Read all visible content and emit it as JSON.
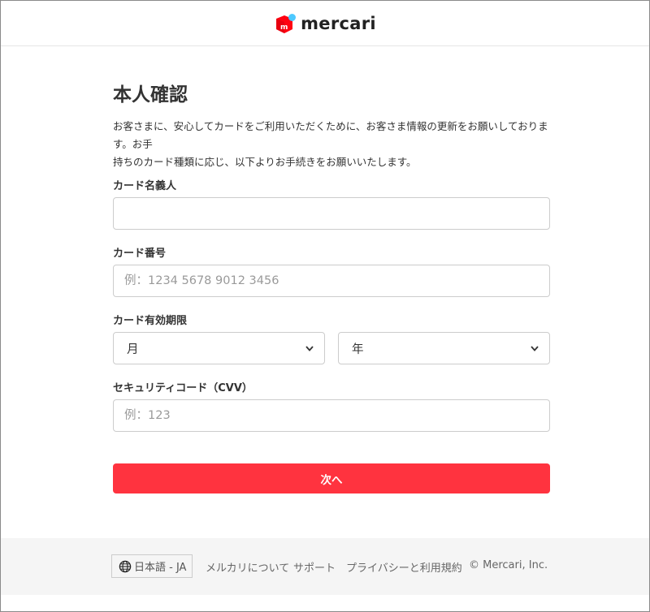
{
  "header": {
    "logo_text": "mercari",
    "logo_mark": "m"
  },
  "main": {
    "title": "本人確認",
    "intro_line1": "お客さまに、安心してカードをご利用いただくために、お客さま情報の更新をお願いしております。お手",
    "intro_line2": "持ちのカード種類に応じ、以下よりお手続きをお願いいたします。",
    "card_name": {
      "label": "カード名義人",
      "value": "",
      "placeholder": ""
    },
    "card_number": {
      "label": "カード番号",
      "value": "",
      "placeholder": "例：1234 5678 9012 3456"
    },
    "expiry": {
      "label": "カード有効期限",
      "month_value": "月",
      "year_value": "年"
    },
    "cvv": {
      "label": "セキュリティコード（CVV）",
      "value": "",
      "placeholder": "例：123"
    },
    "next_button": "次へ"
  },
  "footer": {
    "language": "日本語 - JA",
    "links": [
      "メルカリについて",
      "サポート",
      "プライバシーと利用規約"
    ],
    "copyright": "© Mercari, Inc."
  },
  "colors": {
    "brand_red": "#ff333f",
    "logo_red": "#ff0211",
    "logo_blue": "#4dc9ff",
    "footer_bg": "#f5f5f5"
  },
  "icons": {
    "logo": "mercari-box-icon",
    "select_arrow": "chevron-down-icon",
    "language": "globe-icon"
  }
}
